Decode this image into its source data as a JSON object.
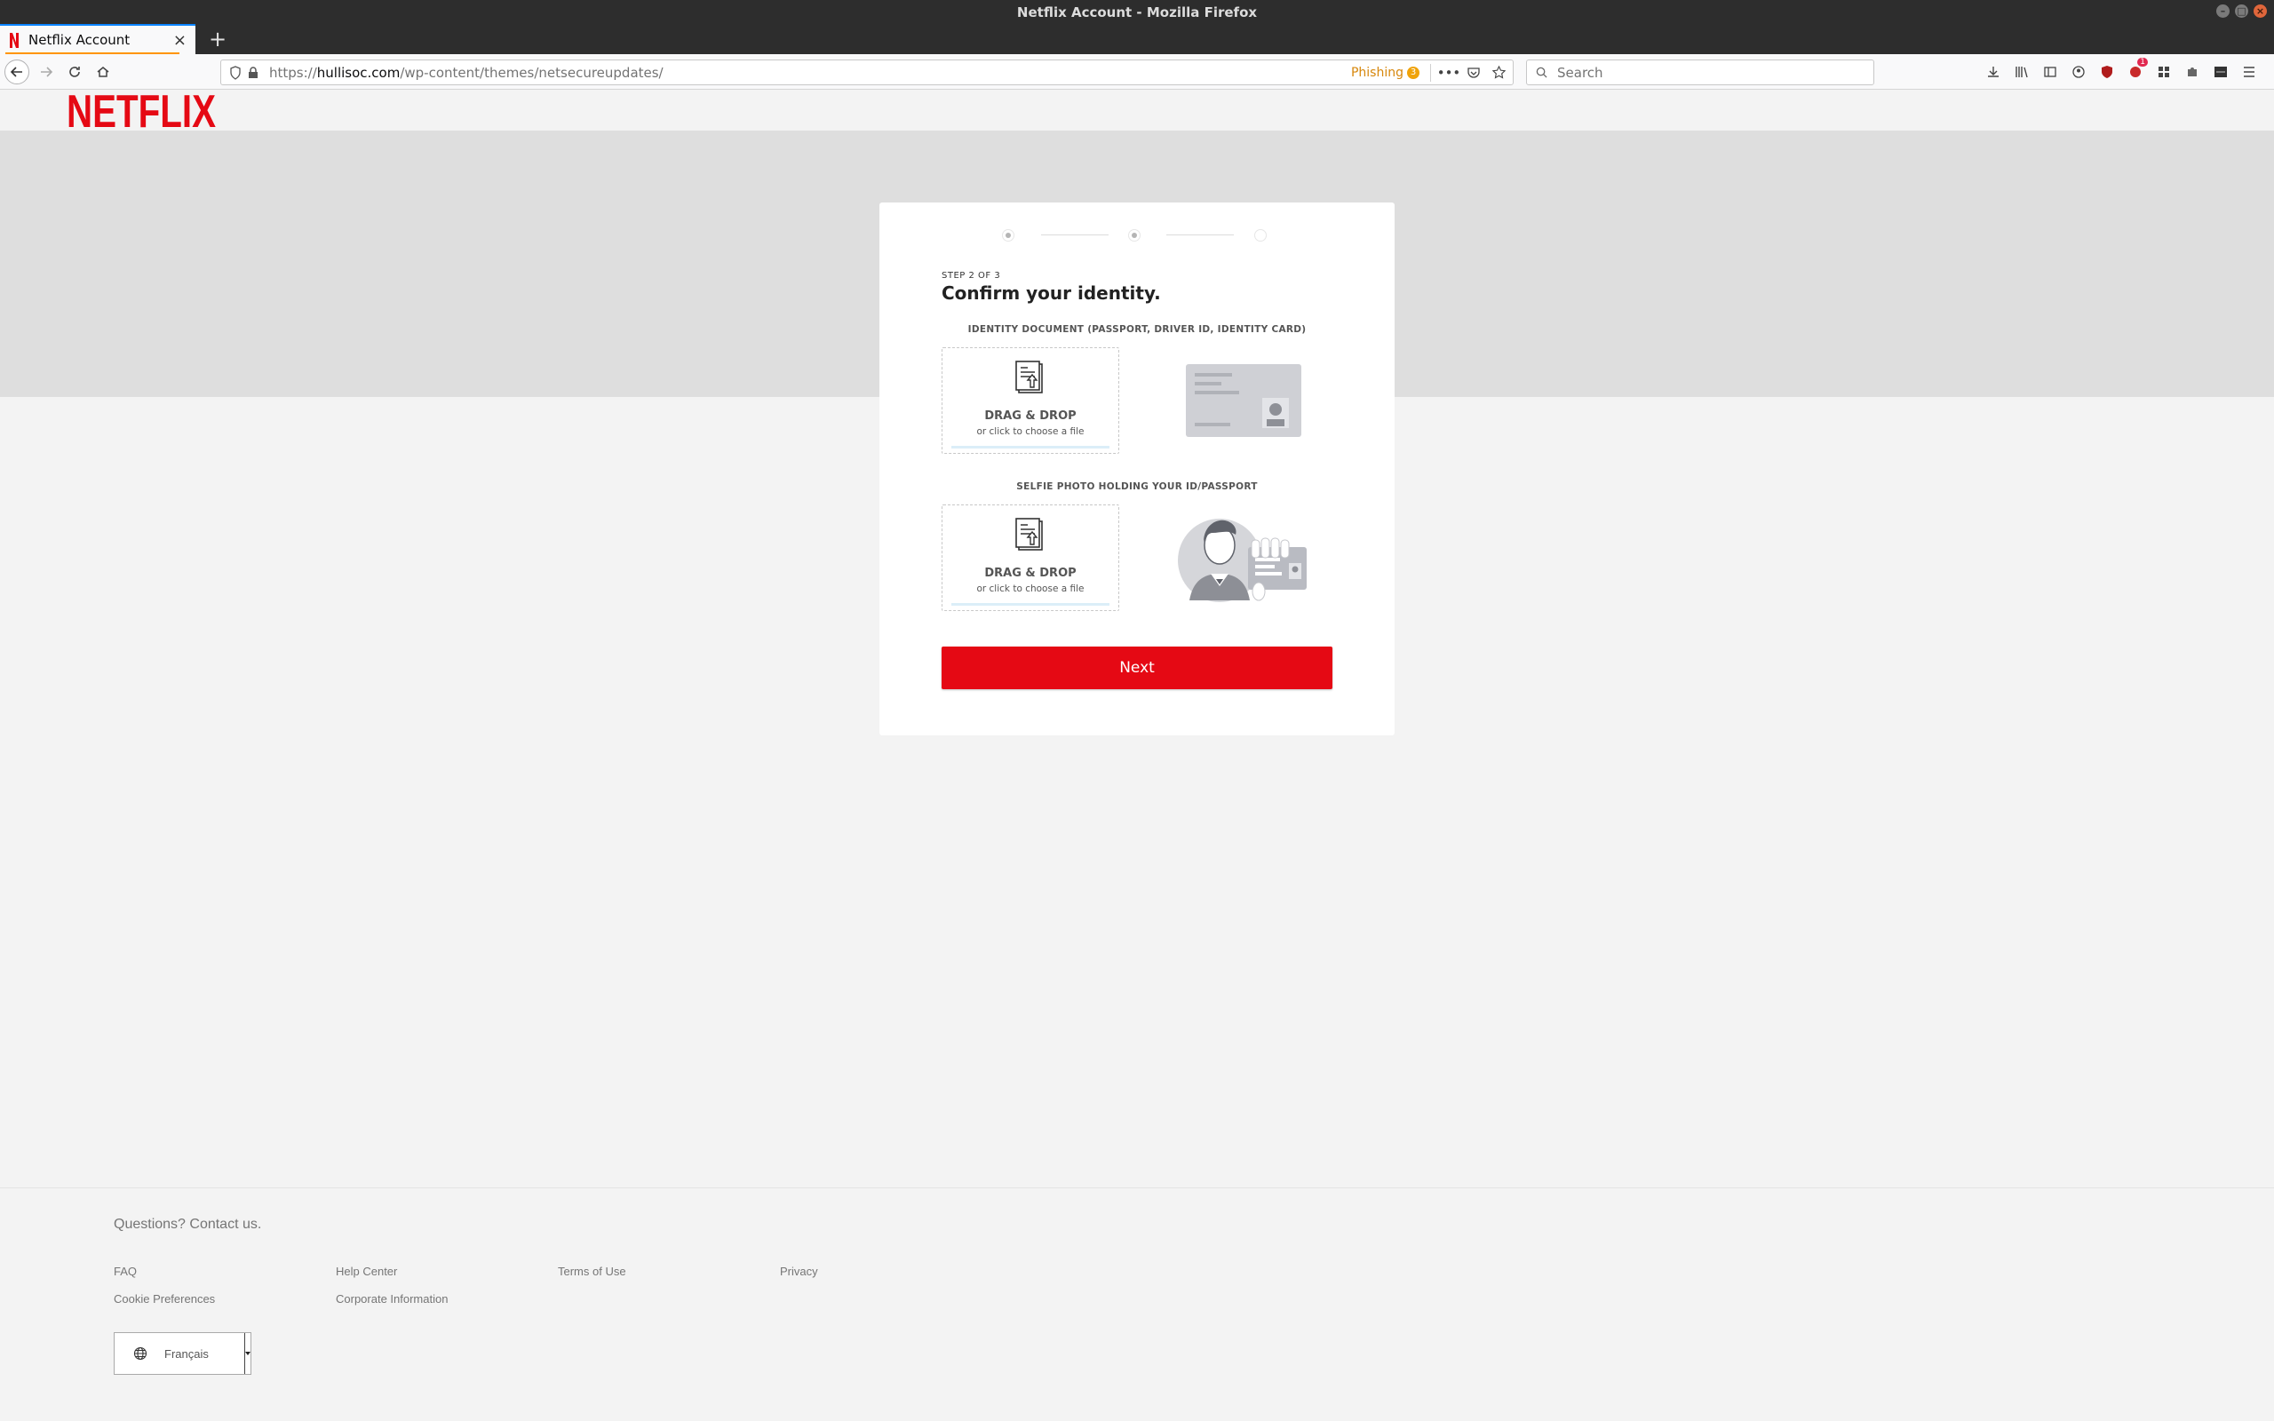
{
  "window": {
    "title": "Netflix Account - Mozilla Firefox"
  },
  "tab": {
    "title": "Netflix Account",
    "favicon": "netflix-n-icon"
  },
  "navbar": {
    "url_host": "hullisoc.com",
    "url_prefix": "https://",
    "url_path": "/wp-content/themes/netsecureupdates/",
    "phishing_label": "Phishing",
    "phishing_count": "3",
    "search_placeholder": "Search",
    "extension_badge": "1"
  },
  "site": {
    "logo_text": "NETFLIX",
    "brand_color": "#e50914"
  },
  "card": {
    "step_indicator": "STEP 2 OF 3",
    "title": "Confirm your identity.",
    "steps": [
      {
        "state": "done"
      },
      {
        "state": "current"
      },
      {
        "state": "pending"
      }
    ],
    "id_section": {
      "label": "IDENTITY DOCUMENT (PASSPORT, DRIVER ID, IDENTITY CARD)",
      "drop_title": "DRAG & DROP",
      "drop_subtitle": "or click to choose a file"
    },
    "selfie_section": {
      "label": "SELFIE PHOTO HOLDING YOUR ID/PASSPORT",
      "drop_title": "DRAG & DROP",
      "drop_subtitle": "or click to choose a file"
    },
    "next_label": "Next"
  },
  "footer": {
    "contact": "Questions? Contact us.",
    "links": [
      "FAQ",
      "Help Center",
      "Terms of Use",
      "Privacy",
      "Cookie Preferences",
      "Corporate Information"
    ],
    "language": "Français"
  }
}
